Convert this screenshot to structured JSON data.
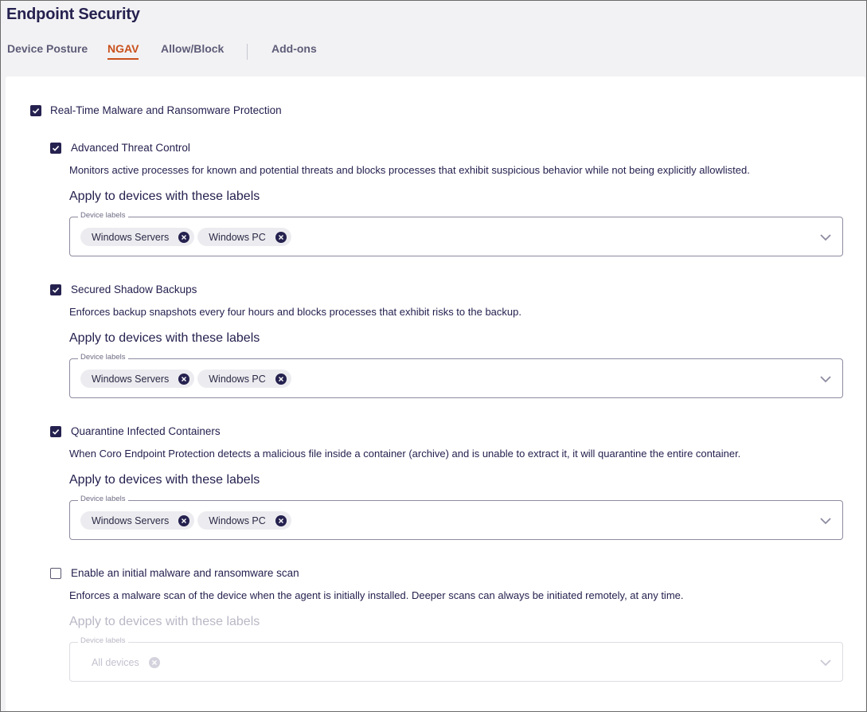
{
  "page": {
    "title": "Endpoint Security"
  },
  "tabs": [
    {
      "label": "Device Posture"
    },
    {
      "label": "NGAV"
    },
    {
      "label": "Allow/Block"
    },
    {
      "label": "Add-ons"
    }
  ],
  "active_tab": "NGAV",
  "main_option": {
    "label": "Real-Time Malware and Ransomware Protection",
    "checked": true
  },
  "sections": [
    {
      "label": "Advanced Threat Control",
      "checked": true,
      "description": "Monitors active processes for known and potential threats and blocks processes that exhibit suspicious behavior while not being explicitly allowlisted.",
      "apply_title": "Apply to devices with these labels",
      "field_legend": "Device labels",
      "chips": [
        "Windows Servers",
        "Windows PC"
      ]
    },
    {
      "label": "Secured Shadow Backups",
      "checked": true,
      "description": "Enforces backup snapshots every four hours and blocks processes that exhibit risks to the backup.",
      "apply_title": "Apply to devices with these labels",
      "field_legend": "Device labels",
      "chips": [
        "Windows Servers",
        "Windows PC"
      ]
    },
    {
      "label": "Quarantine Infected Containers",
      "checked": true,
      "description": "When Coro Endpoint Protection detects a malicious file inside a container (archive) and is unable to extract it, it will quarantine the entire container.",
      "apply_title": "Apply to devices with these labels",
      "field_legend": "Device labels",
      "chips": [
        "Windows Servers",
        "Windows PC"
      ]
    },
    {
      "label": "Enable an initial malware and ransomware scan",
      "checked": false,
      "description": "Enforces a malware scan of the device when the agent is initially installed. Deeper scans can always be initiated remotely, at any time.",
      "apply_title": "Apply to devices with these labels",
      "field_legend": "Device labels",
      "chips": [
        "All devices"
      ]
    }
  ],
  "colors": {
    "primary": "#25214f",
    "accent": "#c9501c",
    "background": "#f2f2f4"
  },
  "icons": {
    "check": "check-icon",
    "chip_remove": "close-circle-icon",
    "dropdown": "chevron-down-icon"
  }
}
